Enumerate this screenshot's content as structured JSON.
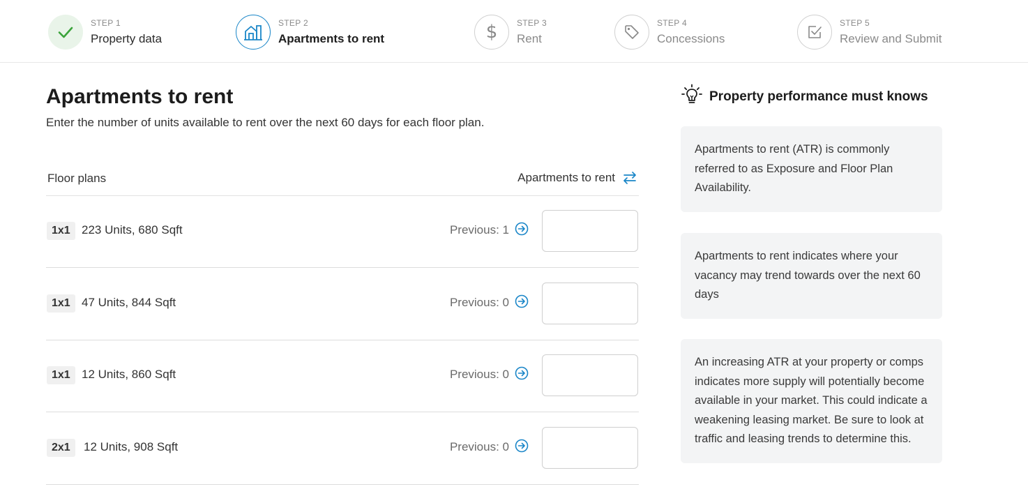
{
  "stepper": {
    "steps": [
      {
        "num": "STEP 1",
        "label": "Property data",
        "icon": "check-icon",
        "state": "done"
      },
      {
        "num": "STEP 2",
        "label": "Apartments to rent",
        "icon": "building-icon",
        "state": "active"
      },
      {
        "num": "STEP 3",
        "label": "Rent",
        "icon": "dollar-icon",
        "state": "todo"
      },
      {
        "num": "STEP 4",
        "label": "Concessions",
        "icon": "tag-icon",
        "state": "todo"
      },
      {
        "num": "STEP 5",
        "label": "Review and Submit",
        "icon": "checkbox-icon",
        "state": "todo"
      }
    ]
  },
  "main": {
    "title": "Apartments to rent",
    "subtitle": "Enter the number of units available to rent over the next 60 days for each floor plan.",
    "table": {
      "col_floor_plans": "Floor plans",
      "col_atr": "Apartments to rent",
      "rows": [
        {
          "badge": "1x1",
          "desc": "223 Units, 680 Sqft",
          "previous": "Previous: 1",
          "value": ""
        },
        {
          "badge": "1x1",
          "desc": "47 Units, 844 Sqft",
          "previous": "Previous: 0",
          "value": ""
        },
        {
          "badge": "1x1",
          "desc": "12 Units, 860 Sqft",
          "previous": "Previous: 0",
          "value": ""
        },
        {
          "badge": "2x1",
          "desc": "12 Units, 908 Sqft",
          "previous": "Previous: 0",
          "value": ""
        }
      ]
    }
  },
  "side": {
    "title": "Property performance must knows",
    "tips": [
      "Apartments to rent (ATR) is commonly referred to as Exposure and Floor Plan Availability.",
      "Apartments to rent indicates where your vacancy may trend towards over the next 60 days",
      "An increasing ATR at your property or comps indicates more supply will potentially become available in your market. This could indicate a weakening leasing market. Be sure to look at traffic and leasing trends to determine this."
    ]
  },
  "colors": {
    "accent": "#1a86c8",
    "done_green": "#3aa33a",
    "done_bg": "#e9f4e9",
    "tip_bg": "#f3f4f5"
  }
}
